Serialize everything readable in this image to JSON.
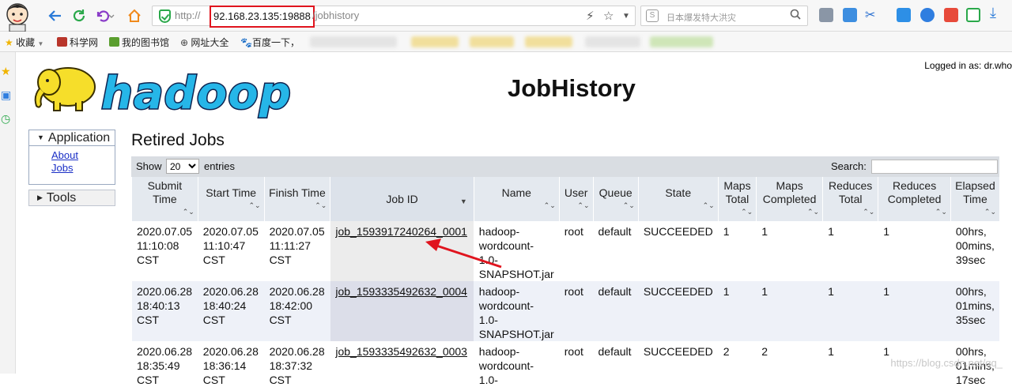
{
  "browser": {
    "url_protocol": "http://",
    "url_host": "92.168.23.135:19888",
    "url_path": "/jobhistory",
    "search_placeholder": "日本爆发特大洪灾",
    "highlight_color": "#e0141e"
  },
  "bookmarks": [
    {
      "label": "收藏",
      "icon": "star-icon"
    },
    {
      "label": "科学网",
      "icon": "site-icon"
    },
    {
      "label": "我的图书馆",
      "icon": "library-icon"
    },
    {
      "label": "网址大全",
      "icon": "globe-icon"
    },
    {
      "label": "百度一下，",
      "icon": "baidu-icon"
    }
  ],
  "page": {
    "logged_in": "Logged in as: dr.who",
    "logo_text": "hadoop",
    "title": "JobHistory",
    "section_title": "Retired Jobs"
  },
  "nav": {
    "application_label": "Application",
    "links": [
      "About",
      "Jobs"
    ],
    "tools_label": "Tools"
  },
  "controls": {
    "show_label": "Show",
    "page_size": "20",
    "entries_label": "entries",
    "search_label": "Search:"
  },
  "table": {
    "headers": [
      "Submit Time",
      "Start Time",
      "Finish Time",
      "Job ID",
      "Name",
      "User",
      "Queue",
      "State",
      "Maps Total",
      "Maps Completed",
      "Reduces Total",
      "Reduces Completed",
      "Elapsed Time"
    ],
    "rows": [
      {
        "submit": [
          "2020.07.05",
          "11:10:08",
          "CST"
        ],
        "start": [
          "2020.07.05",
          "11:10:47",
          "CST"
        ],
        "finish": [
          "2020.07.05",
          "11:11:27",
          "CST"
        ],
        "job_id": "job_1593917240264_0001",
        "name": [
          "hadoop-",
          "wordcount-",
          "1.0-",
          "SNAPSHOT.jar"
        ],
        "user": "root",
        "queue": "default",
        "state": "SUCCEEDED",
        "maps_total": "1",
        "maps_completed": "1",
        "reduces_total": "1",
        "reduces_completed": "1",
        "elapsed": [
          "00hrs,",
          "00mins,",
          "39sec"
        ]
      },
      {
        "submit": [
          "2020.06.28",
          "18:40:13",
          "CST"
        ],
        "start": [
          "2020.06.28",
          "18:40:24",
          "CST"
        ],
        "finish": [
          "2020.06.28",
          "18:42:00",
          "CST"
        ],
        "job_id": "job_1593335492632_0004",
        "name": [
          "hadoop-",
          "wordcount-",
          "1.0-",
          "SNAPSHOT.jar"
        ],
        "user": "root",
        "queue": "default",
        "state": "SUCCEEDED",
        "maps_total": "1",
        "maps_completed": "1",
        "reduces_total": "1",
        "reduces_completed": "1",
        "elapsed": [
          "00hrs,",
          "01mins,",
          "35sec"
        ]
      },
      {
        "submit": [
          "2020.06.28",
          "18:35:49",
          "CST"
        ],
        "start": [
          "2020.06.28",
          "18:36:14",
          "CST"
        ],
        "finish": [
          "2020.06.28",
          "18:37:32",
          "CST"
        ],
        "job_id": "job_1593335492632_0003",
        "name": [
          "hadoop-",
          "wordcount-",
          "1.0-"
        ],
        "user": "root",
        "queue": "default",
        "state": "SUCCEEDED",
        "maps_total": "2",
        "maps_completed": "2",
        "reduces_total": "1",
        "reduces_completed": "1",
        "elapsed": [
          "00hrs,",
          "01mins,",
          "17sec"
        ]
      }
    ]
  },
  "watermark": "https://blog.csdn.net/qq_        "
}
